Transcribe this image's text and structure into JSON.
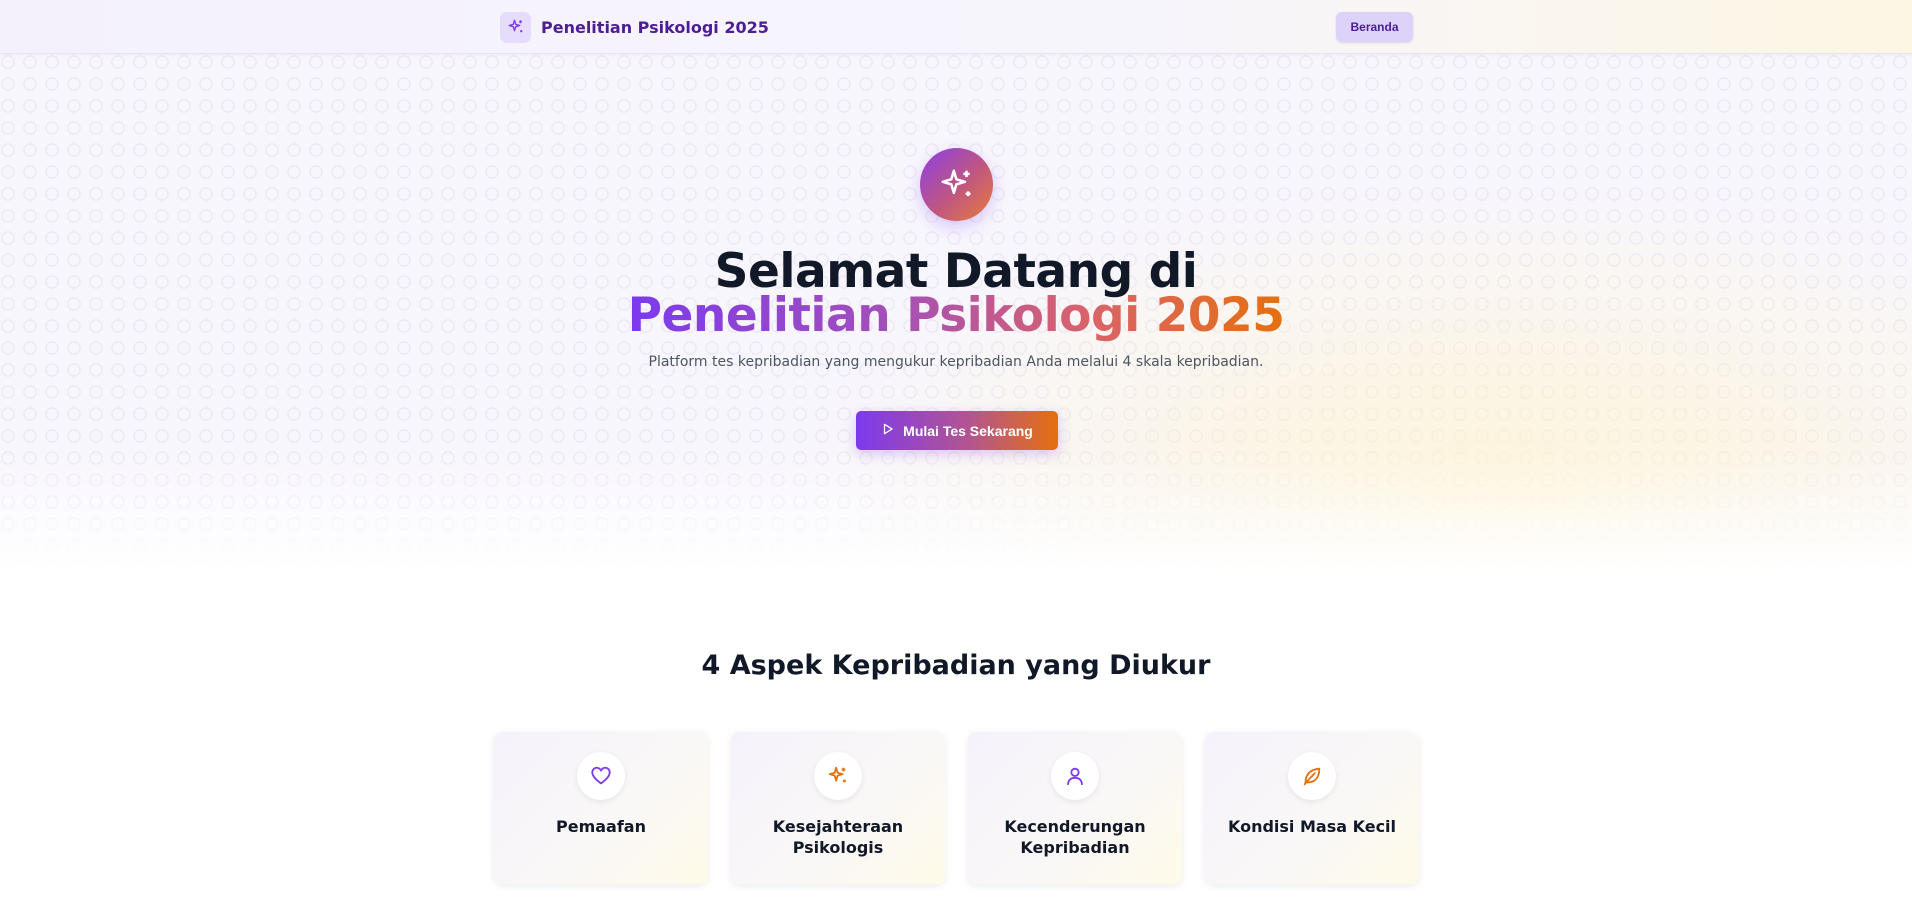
{
  "nav": {
    "brand_icon": "sparkles-icon",
    "brand_title": "Penelitian Psikologi 2025",
    "home_label": "Beranda"
  },
  "hero": {
    "icon": "sparkles-icon",
    "title_line1": "Selamat Datang di",
    "title_line2": "Penelitian Psikologi 2025",
    "subtitle": "Platform tes kepribadian yang mengukur kepribadian Anda melalui 4 skala kepribadian.",
    "cta_icon": "play-icon",
    "cta_label": "Mulai Tes Sekarang"
  },
  "aspects": {
    "title": "4 Aspek Kepribadian yang Diukur",
    "cards": [
      {
        "icon": "heart-icon",
        "label": "Pemaafan",
        "color": "#7c3aed"
      },
      {
        "icon": "sparkles-icon",
        "label": "Kesejahteraan Psikologis",
        "color": "#e5700e"
      },
      {
        "icon": "user-icon",
        "label": "Kecenderungan Kepribadian",
        "color": "#7c3aed"
      },
      {
        "icon": "leaf-icon",
        "label": "Kondisi Masa Kecil",
        "color": "#e5700e"
      }
    ]
  },
  "colors": {
    "primary": "#7c3aed",
    "accent": "#e5700e",
    "brand_dark": "#4c1d95"
  }
}
